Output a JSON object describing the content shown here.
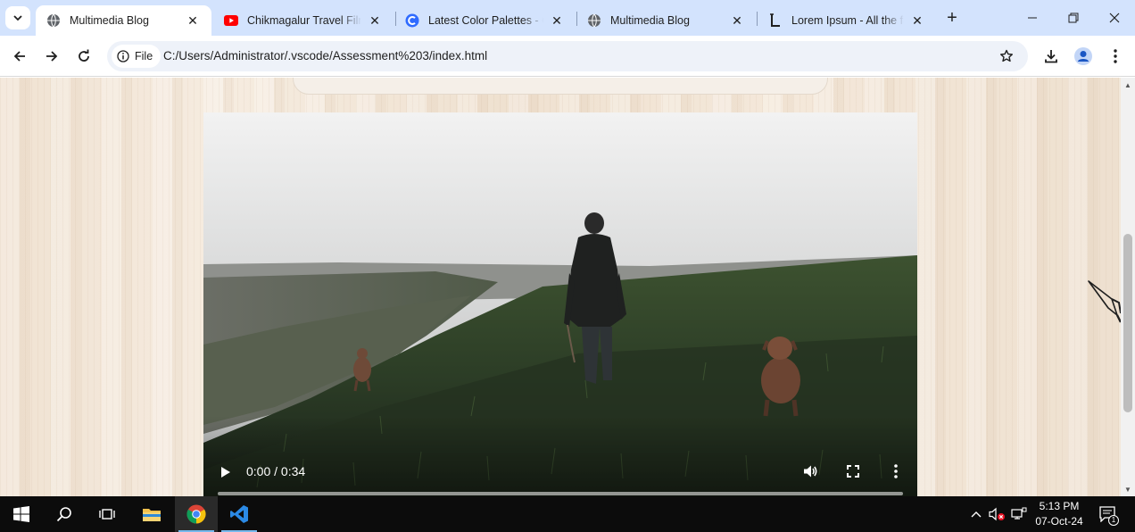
{
  "browser": {
    "tabs": [
      {
        "title": "Multimedia Blog",
        "favicon": "globe-icon",
        "active": true
      },
      {
        "title": "Chikmagalur Travel Film | Cinematic",
        "favicon": "youtube-icon",
        "active": false
      },
      {
        "title": "Latest Color Palettes - Coolors",
        "favicon": "coolors-icon",
        "active": false
      },
      {
        "title": "Multimedia Blog",
        "favicon": "globe-icon",
        "active": false
      },
      {
        "title": "Lorem Ipsum - All the facts - Lipsum",
        "favicon": "lipsum-icon",
        "active": false
      }
    ],
    "address": {
      "chip_label": "File",
      "url": "C:/Users/Administrator/.vscode/Assessment%203/index.html"
    }
  },
  "video": {
    "time_display": "0:00 / 0:34",
    "progress_fraction": 0.0,
    "controls": [
      "play-icon",
      "volume-icon",
      "fullscreen-icon",
      "more-options-icon"
    ]
  },
  "taskbar": {
    "apps": [
      "windows-start-icon",
      "search-icon",
      "task-view-icon",
      "file-explorer-icon",
      "chrome-icon",
      "vscode-icon"
    ],
    "clock_time": "5:13 PM",
    "clock_date": "07-Oct-24",
    "notification_count": "1"
  },
  "colors": {
    "tabstrip": "#d3e3fd",
    "page_background": "#f1e5d6",
    "taskbar": "#0c0c0c",
    "accent": "#76b9ed"
  }
}
